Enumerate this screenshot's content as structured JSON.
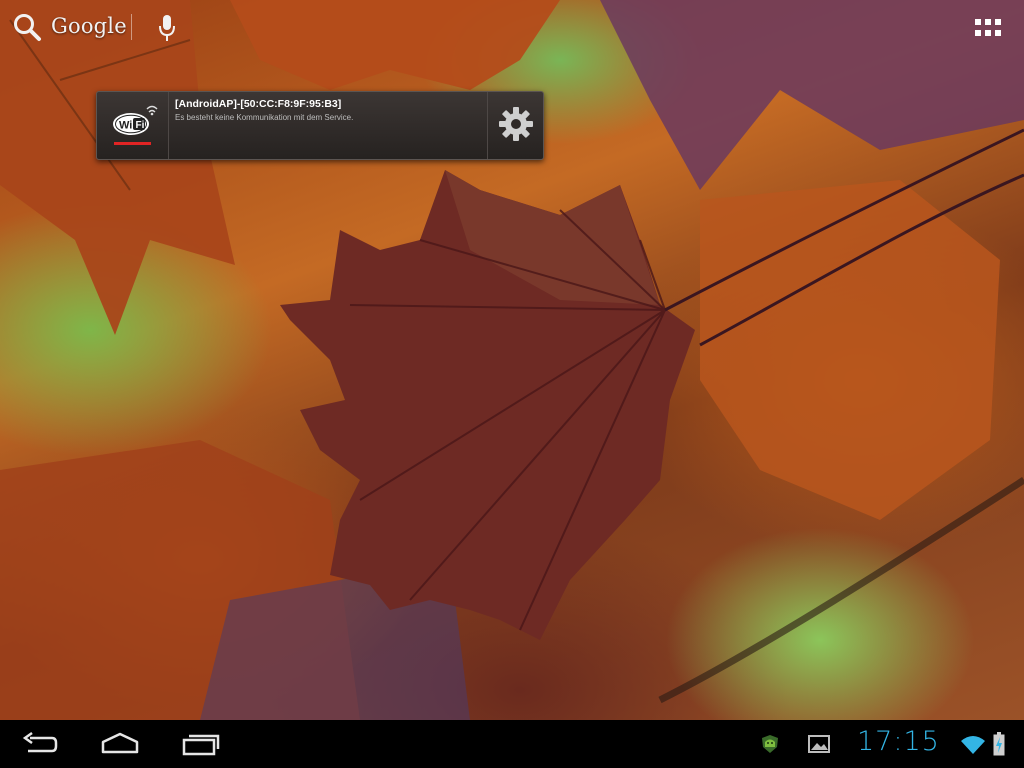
{
  "search": {
    "label": "Google",
    "icon": "search-icon",
    "voice_icon": "mic-icon"
  },
  "launcher": {
    "apps_icon": "apps-grid-icon"
  },
  "notification": {
    "icon": "wifi-logo-icon",
    "title": "[AndroidAP]-[50:CC:F8:9F:95:B3]",
    "text": "Es besteht keine Kommunikation mit dem Service.",
    "settings_icon": "gear-icon",
    "accent_color": "#e12424"
  },
  "navbar": {
    "buttons": [
      "back-icon",
      "home-icon",
      "recent-apps-icon"
    ],
    "status_icons": [
      "android-badge-icon",
      "gallery-icon",
      "wifi-signal-icon",
      "battery-charging-icon"
    ],
    "clock": "17:15",
    "clock_color": "#33b5e5"
  },
  "wallpaper": {
    "description_icon": "autumn-leaves-wallpaper"
  }
}
